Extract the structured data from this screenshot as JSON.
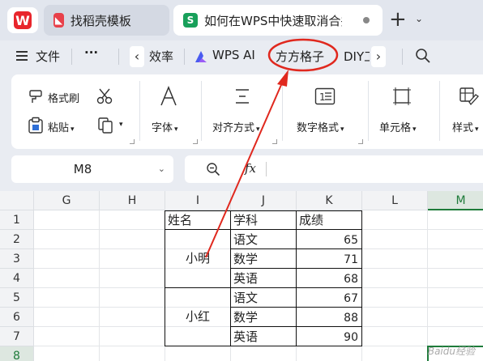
{
  "titlebar": {
    "logo_letter": "W",
    "tabs": [
      {
        "icon": "wps-template-icon",
        "icon_glyph": "◣",
        "label": "找稻壳模板"
      },
      {
        "icon": "spreadsheet-icon",
        "icon_glyph": "S",
        "label": "如何在WPS中快速取消合并"
      }
    ],
    "new_tab": "+",
    "new_tab_menu": "⌄"
  },
  "menubar": {
    "file_label": "文件",
    "more_label": "···",
    "prev": "‹",
    "next": "›",
    "items": [
      "效率",
      "WPS AI",
      "方方格子",
      "DIY工"
    ],
    "highlighted_item": "方方格子"
  },
  "ribbon": {
    "format_painter": "格式刷",
    "paste": "粘贴",
    "font": "字体",
    "align": "对齐方式",
    "number_format": "数字格式",
    "cell": "单元格",
    "style": "样式"
  },
  "formula_bar": {
    "cell_ref": "M8",
    "fx": "fx",
    "formula_value": ""
  },
  "sheet": {
    "columns": [
      "G",
      "H",
      "I",
      "J",
      "K",
      "L",
      "M"
    ],
    "selected_column": "M",
    "rows": [
      "1",
      "2",
      "3",
      "4",
      "5",
      "6",
      "7",
      "8"
    ],
    "selected_row": "8",
    "header": {
      "name": "姓名",
      "subject": "学科",
      "score": "成绩"
    },
    "students": [
      {
        "name": "小明",
        "records": [
          {
            "subject": "语文",
            "score": "65"
          },
          {
            "subject": "数学",
            "score": "71"
          },
          {
            "subject": "英语",
            "score": "68"
          }
        ]
      },
      {
        "name": "小红",
        "records": [
          {
            "subject": "语文",
            "score": "67"
          },
          {
            "subject": "数学",
            "score": "88"
          },
          {
            "subject": "英语",
            "score": "90"
          }
        ]
      }
    ]
  },
  "annotation": {
    "color": "#e0281e"
  },
  "colors": {
    "accent_green": "#1e7b3a",
    "wps_red": "#e8252c"
  },
  "watermark": "Baidu经验"
}
